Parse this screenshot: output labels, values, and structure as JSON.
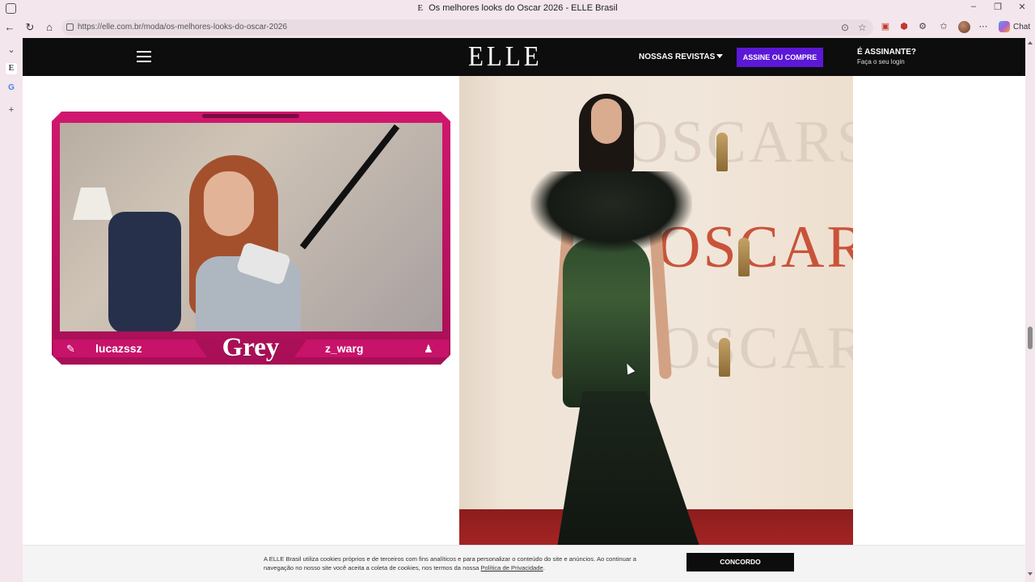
{
  "browser": {
    "window_title": "Os melhores looks do Oscar 2026 - ELLE Brasil",
    "favicon_letter": "E",
    "url": "https://elle.com.br/moda/os-melhores-looks-do-oscar-2026",
    "chat_label": "Chat",
    "side_active_letter": "E",
    "side_google_letter": "G"
  },
  "site": {
    "logo": "ELLE",
    "nav_revistas": "NOSSAS REVISTAS",
    "subscribe_button": "ASSINE OU COMPRE",
    "assinante_title": "É ASSINANTE?",
    "assinante_login": "Faça o seu login"
  },
  "photo": {
    "backdrop_text": "OSCARS"
  },
  "stream_overlay": {
    "title": "Grey",
    "left_handle": "lucazssz",
    "right_handle": "z_warg"
  },
  "cookie_banner": {
    "text": "A ELLE Brasil utiliza cookies próprios e de terceiros com fins analíticos e para personalizar o conteúdo do site e anúncios. Ao continuar a navegação no nosso site você aceita a coleta de cookies, nos termos da nossa ",
    "link": "Política de Privacidade",
    "text_end": ".",
    "agree_button": "CONCORDO"
  },
  "colors": {
    "brand_purple": "#5b18d6",
    "overlay_pink": "#c7136a",
    "header_black": "#0d0d0d"
  }
}
